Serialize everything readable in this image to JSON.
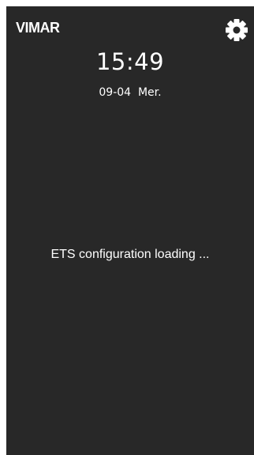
{
  "header": {
    "brand": "VIMAR",
    "settings_icon": "gear-icon"
  },
  "clock": {
    "time": "15:49",
    "date": "09-04  Mer."
  },
  "status": {
    "message": "ETS configuration loading ..."
  },
  "colors": {
    "background": "#282828",
    "foreground": "#ffffff"
  }
}
